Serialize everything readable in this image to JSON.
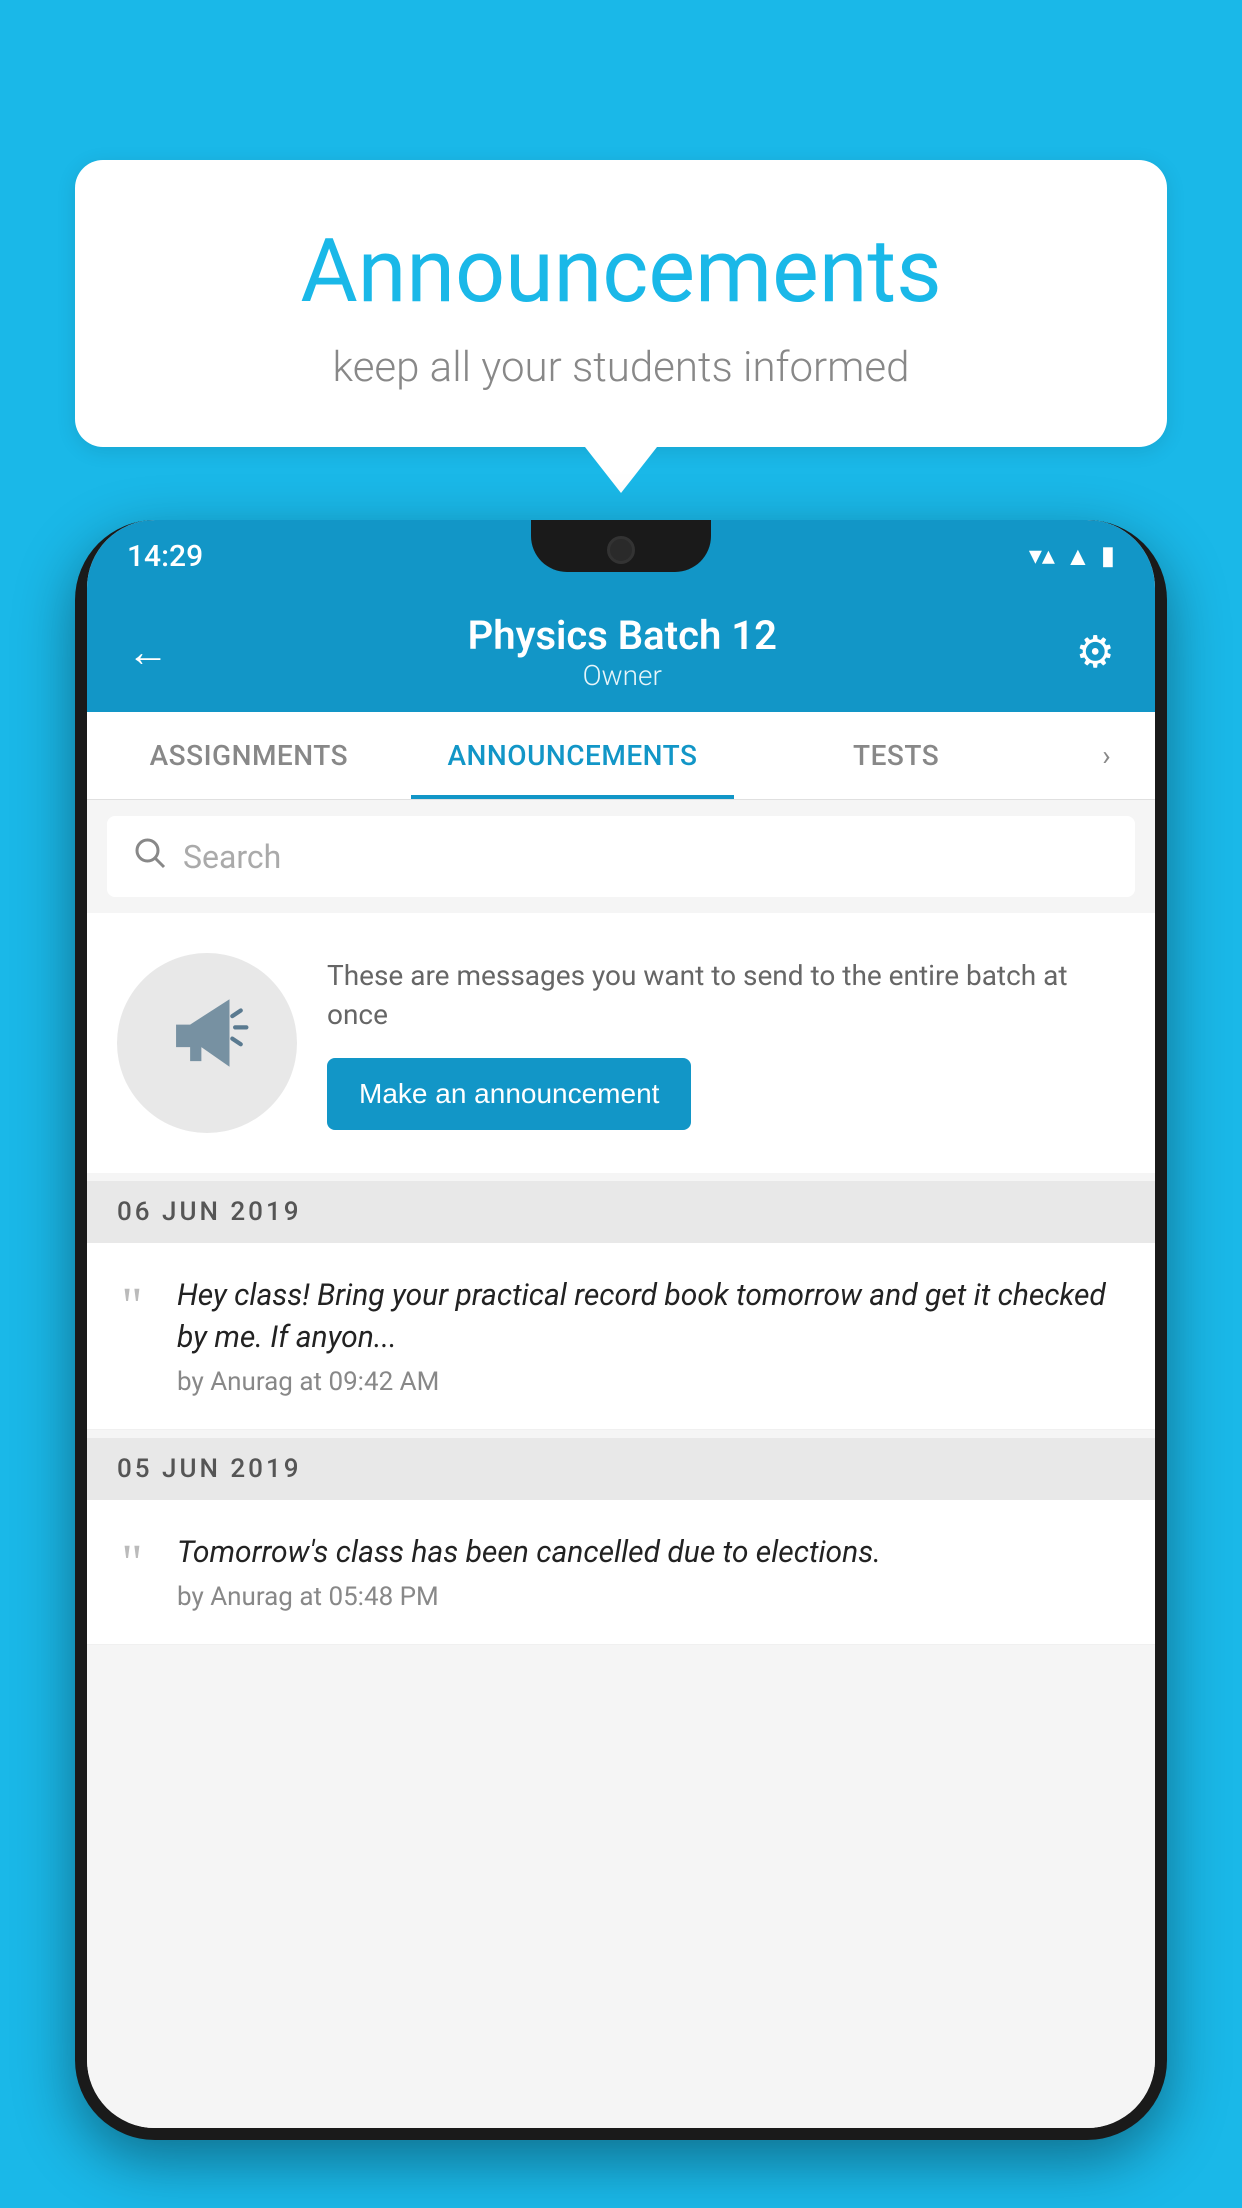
{
  "background": {
    "color": "#1ab8e8"
  },
  "speech_bubble": {
    "title": "Announcements",
    "subtitle": "keep all your students informed"
  },
  "status_bar": {
    "time": "14:29",
    "wifi": "▼",
    "signal": "▲",
    "battery": "▪"
  },
  "app_bar": {
    "back_label": "←",
    "title": "Physics Batch 12",
    "subtitle": "Owner",
    "settings_label": "⚙"
  },
  "tabs": [
    {
      "label": "ASSIGNMENTS",
      "active": false
    },
    {
      "label": "ANNOUNCEMENTS",
      "active": true
    },
    {
      "label": "TESTS",
      "active": false
    }
  ],
  "search": {
    "placeholder": "Search"
  },
  "promo": {
    "description": "These are messages you want to send to the entire batch at once",
    "button_label": "Make an announcement"
  },
  "announcements": [
    {
      "date": "06  JUN  2019",
      "message": "Hey class! Bring your practical record book tomorrow and get it checked by me. If anyon...",
      "meta": "by Anurag at 09:42 AM"
    },
    {
      "date": "05  JUN  2019",
      "message": "Tomorrow's class has been cancelled due to elections.",
      "meta": "by Anurag at 05:48 PM"
    }
  ]
}
